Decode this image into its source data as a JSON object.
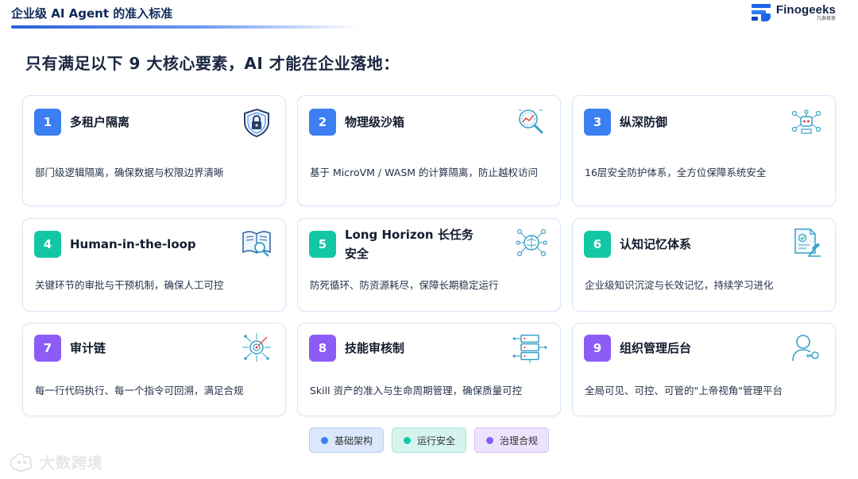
{
  "header": {
    "title": "企业级 AI Agent 的准入标准"
  },
  "brand": {
    "name": "Finogeeks",
    "sub": "凡泰极客"
  },
  "subtitle": "只有满足以下 9 大核心要素，AI 才能在企业落地：",
  "cards": [
    {
      "num": "1",
      "title": "多租户隔离",
      "desc": "部门级逻辑隔离，确保数据与权限边界清晰",
      "category": "基础架构",
      "icon": "shield-lock-icon"
    },
    {
      "num": "2",
      "title": "物理级沙箱",
      "desc": "基于 MicroVM / WASM 的计算隔离，防止越权访问",
      "category": "基础架构",
      "icon": "magnifier-chart-icon"
    },
    {
      "num": "3",
      "title": "纵深防御",
      "desc": "16层安全防护体系，全方位保障系统安全",
      "category": "基础架构",
      "icon": "robot-network-icon"
    },
    {
      "num": "4",
      "title": "Human-in-the-loop",
      "desc": "关键环节的审批与干预机制，确保人工可控",
      "category": "运行安全",
      "icon": "book-magnifier-icon"
    },
    {
      "num": "5",
      "title_line1": "Long Horizon 长任务",
      "title_line2": "安全",
      "desc": "防死循环、防资源耗尽，保障长期稳定运行",
      "category": "运行安全",
      "icon": "brain-network-icon"
    },
    {
      "num": "6",
      "title": "认知记忆体系",
      "desc": "企业级知识沉淀与长效记忆，持续学习进化",
      "category": "运行安全",
      "icon": "document-gavel-icon"
    },
    {
      "num": "7",
      "title": "审计链",
      "desc": "每一行代码执行、每一个指令可回溯，满足合规",
      "category": "治理合规",
      "icon": "target-network-icon"
    },
    {
      "num": "8",
      "title": "技能审核制",
      "desc": "Skill 资产的准入与生命周期管理，确保质量可控",
      "category": "治理合规",
      "icon": "server-network-icon"
    },
    {
      "num": "9",
      "title": "组织管理后台",
      "desc": "全局可见、可控、可管的\"上帝视角\"管理平台",
      "category": "治理合规",
      "icon": "user-key-icon"
    }
  ],
  "legend": [
    {
      "label": "基础架构",
      "color": "#3b7ff2",
      "bg": "#dbe8fb"
    },
    {
      "label": "运行安全",
      "color": "#14c7a4",
      "bg": "#d6f4ee"
    },
    {
      "label": "治理合规",
      "color": "#8b5cf6",
      "bg": "#ece4fc"
    }
  ],
  "watermark": "大数跨境"
}
